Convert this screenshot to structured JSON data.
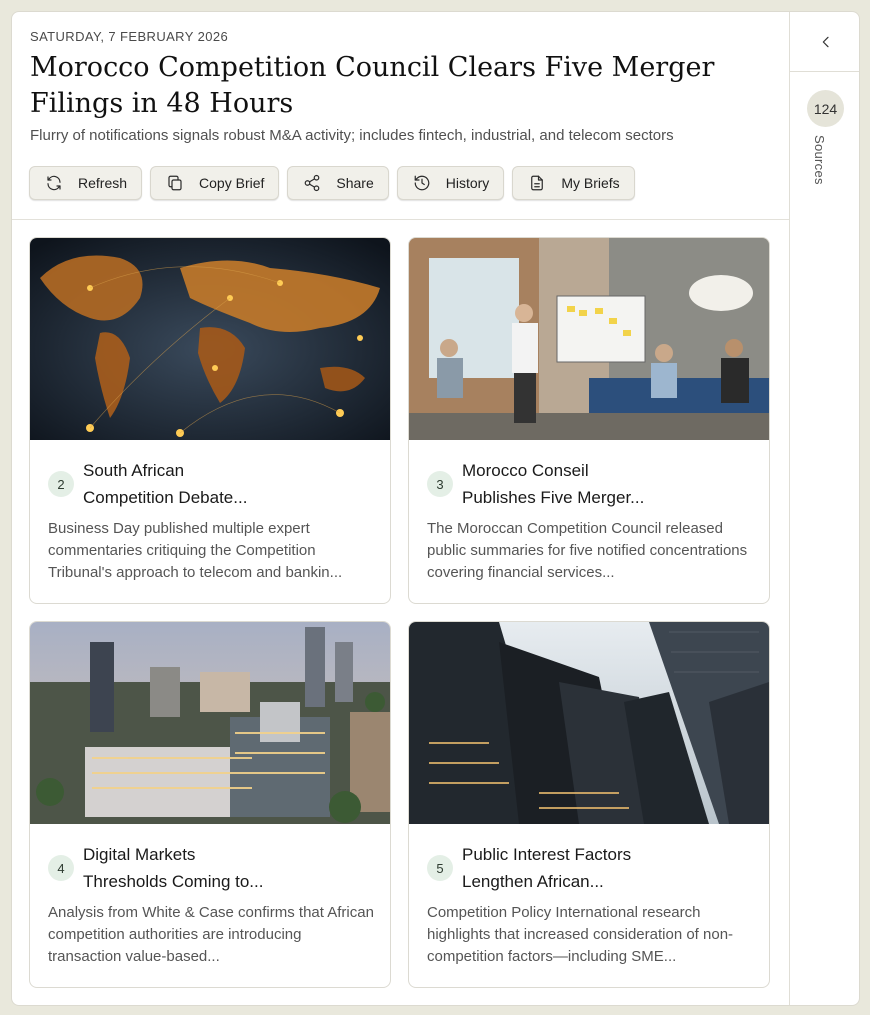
{
  "brief": {
    "date": "SATURDAY, 7 FEBRUARY 2026",
    "title": "Morocco Competition Council Clears Five Merger Filings in 48 Hours",
    "subtitle": "Flurry of notifications signals robust M&A activity; includes fintech, industrial, and telecom sectors"
  },
  "toolbar": {
    "refresh": {
      "label": "Refresh",
      "icon": "refresh-icon"
    },
    "copy": {
      "label": "Copy Brief",
      "icon": "copy-icon"
    },
    "share": {
      "label": "Share",
      "icon": "share-icon"
    },
    "history": {
      "label": "History",
      "icon": "history-icon"
    },
    "briefs": {
      "label": "My Briefs",
      "icon": "document-icon"
    }
  },
  "cards": [
    {
      "number": "2",
      "title": "South African Competition Debate...",
      "title_lines": [
        "South African",
        "Competition Debate..."
      ],
      "description": "Business Day published multiple expert commentaries critiquing the Competition Tribunal's approach to telecom and bankin...",
      "image": "world-map-lights-image"
    },
    {
      "number": "3",
      "title": "Morocco Conseil Publishes Five Merger...",
      "title_lines": [
        "Morocco Conseil",
        "Publishes Five Merger..."
      ],
      "description": "The Moroccan Competition Council released public summaries for five notified concentrations covering financial services...",
      "image": "office-meeting-image"
    },
    {
      "number": "4",
      "title": "Digital Markets Thresholds Coming to...",
      "title_lines": [
        "Digital Markets",
        "Thresholds Coming to..."
      ],
      "description": "Analysis from White & Case confirms that African competition authorities are introducing transaction value-based...",
      "image": "city-skyline-image"
    },
    {
      "number": "5",
      "title": "Public Interest Factors Lengthen African...",
      "title_lines": [
        "Public Interest Factors",
        "Lengthen African..."
      ],
      "description": "Competition Policy International research highlights that increased consideration of non-competition factors—including SME...",
      "image": "skyscrapers-image"
    }
  ],
  "sources": {
    "count": "124",
    "label": "Sources"
  },
  "colors": {
    "background": "#e9e8dc",
    "button_bg": "#f1f0ea",
    "badge_bg": "#e4efe6"
  }
}
